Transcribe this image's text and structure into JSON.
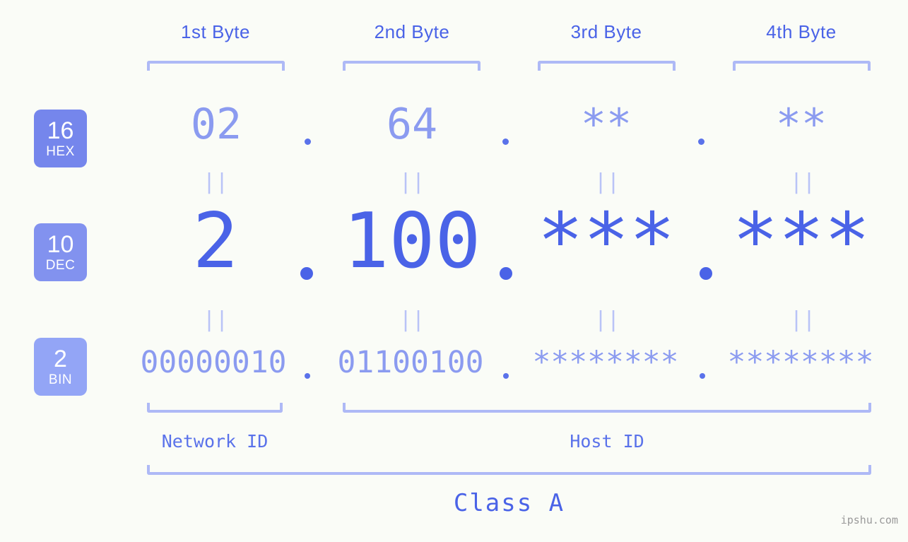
{
  "meta": {
    "background_color": "#fafcf7",
    "accent_color": "#4a63e7",
    "muted_color": "#8b9bf0",
    "bracket_color": "#aeb9f6",
    "watermark": "ipshu.com"
  },
  "byte_headers": [
    {
      "label": "1st Byte"
    },
    {
      "label": "2nd Byte"
    },
    {
      "label": "3rd Byte"
    },
    {
      "label": "4th Byte"
    }
  ],
  "bases": [
    {
      "id": "hex",
      "number": "16",
      "name": "HEX",
      "color": "#7586ec"
    },
    {
      "id": "dec",
      "number": "10",
      "name": "DEC",
      "color": "#8292ef"
    },
    {
      "id": "bin",
      "number": "2",
      "name": "BIN",
      "color": "#93a5f6"
    }
  ],
  "rows": {
    "hex": {
      "values": [
        "02",
        "64",
        "**",
        "**"
      ]
    },
    "dec": {
      "values": [
        "2",
        "100",
        "***",
        "***"
      ]
    },
    "bin": {
      "values": [
        "00000010",
        "01100100",
        "********",
        "********"
      ]
    }
  },
  "separators": {
    "dot": ".",
    "equals": "||"
  },
  "segments": [
    {
      "label": "Network ID"
    },
    {
      "label": "Host ID"
    }
  ],
  "class": {
    "label": "Class A"
  }
}
